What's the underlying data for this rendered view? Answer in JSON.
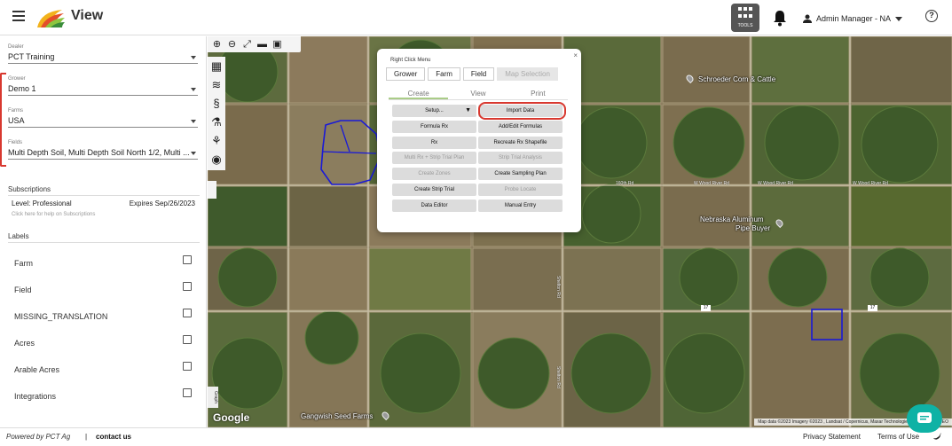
{
  "header": {
    "title": "View",
    "tools_label": "TOOLS",
    "user_name": "Admin Manager - NA",
    "help_glyph": "?"
  },
  "sidebar": {
    "dealer": {
      "label": "Dealer",
      "value": "PCT Training"
    },
    "grower": {
      "label": "Grower",
      "value": "Demo 1"
    },
    "farms": {
      "label": "Farms",
      "value": "USA"
    },
    "fields": {
      "label": "Fields",
      "value": "Multi Depth Soil, Multi Depth Soil North 1/2, Multi ..."
    },
    "subscriptions": {
      "title": "Subscriptions",
      "level": "Level: Professional",
      "expires": "Expires Sep/26/2023",
      "help": "Click here for help on Subscriptions"
    },
    "labels": {
      "title": "Labels",
      "items": [
        "Farm",
        "Field",
        "MISSING_TRANSLATION",
        "Acres",
        "Arable Acres",
        "Integrations"
      ]
    }
  },
  "map": {
    "toolbar_icons": [
      "zoom-in-icon",
      "zoom-out-icon",
      "fullscreen-icon",
      "briefcase-icon",
      "screenshot-icon"
    ],
    "left_tool_icons": [
      "map-layers-icon",
      "layers-icon",
      "soil-icon",
      "lab-flask-icon",
      "plant-icon",
      "camera-icon"
    ],
    "places": {
      "schroeder": "Schroeder Corn & Cattle",
      "nebraska_1": "Nebraska Aluminum",
      "nebraska_2": "Pipe Buyer",
      "gangwish": "Gangwish Seed Farms"
    },
    "roads": {
      "rd160": "160th Rd",
      "wood1": "W Wood River Rd",
      "wood2": "W Wood River Rd",
      "wood3": "W Wood River Rd",
      "shelton1": "Shelton Rd",
      "shelton2": "Shelton Rd",
      "route1": "17",
      "route2": "17"
    },
    "google": "Google",
    "graph_tab": "Graph",
    "attribution": "Map data ©2023 Imagery ©2023 , Landsat / Copernicus, Maxar Technologies, USDA/FPAC/GEO"
  },
  "popup": {
    "title": "Right Click Menu",
    "close": "×",
    "scope_tabs": [
      "Grower",
      "Farm",
      "Field",
      "Map Selection"
    ],
    "mode_tabs": [
      "Create",
      "View",
      "Print"
    ],
    "buttons": {
      "setup": "Setup...",
      "import_data": "Import Data",
      "formula_rx": "Formula Rx",
      "add_edit_formulas": "Add/Edit Formulas",
      "rx": "Rx",
      "recreate_rx_shapefile": "Recreate Rx Shapefile",
      "multi_rx_strip": "Multi Rx + Strip Trial Plan",
      "strip_trial_analysis": "Strip Trial Analysis",
      "create_zones": "Create Zones",
      "create_sampling_plan": "Create Sampling Plan",
      "create_strip_trial": "Create Strip Trial",
      "probe_locate": "Probe Locate",
      "data_editor": "Data Editor",
      "manual_entry": "Manual Entry"
    }
  },
  "footer": {
    "powered": "Powered by PCT Ag",
    "separator": "|",
    "contact": "contact us",
    "privacy": "Privacy Statement",
    "terms": "Terms of Use"
  },
  "colors": {
    "accent_red": "#d8382f",
    "field_outline": "#1a1ad6",
    "chat_teal": "#0fb2a5"
  }
}
